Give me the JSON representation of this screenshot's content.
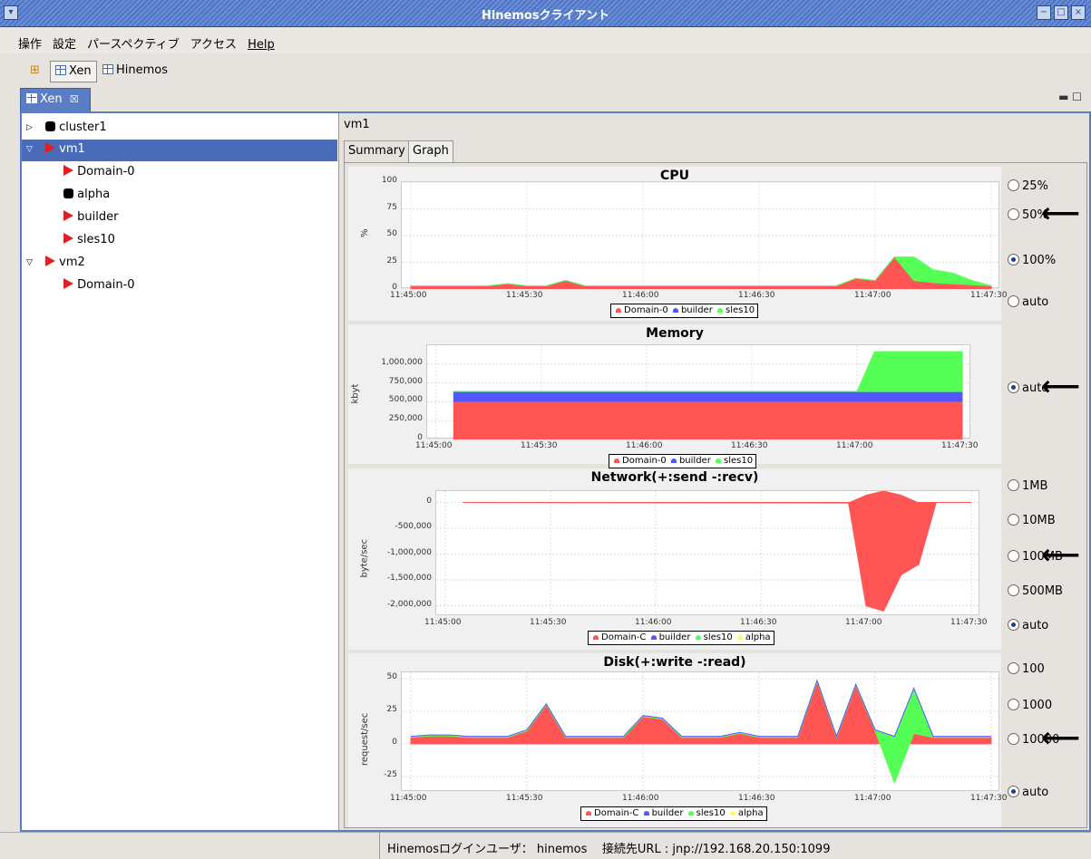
{
  "window": {
    "title": "Hinemosクライアント",
    "controls": [
      "−",
      "□",
      "×"
    ]
  },
  "menu": [
    "操作",
    "設定",
    "パースペクティブ",
    "アクセス",
    "Help"
  ],
  "toolbar": {
    "perspectives": [
      "Xen",
      "Hinemos"
    ],
    "selected": "Xen"
  },
  "view_tab": {
    "label": "Xen",
    "close_icon": "close-icon"
  },
  "tree": [
    {
      "label": "cluster1",
      "icon": "black-node-icon",
      "expander": "▷",
      "depth": 0
    },
    {
      "label": "vm1",
      "icon": "red-arrow-icon",
      "expander": "▽",
      "depth": 0,
      "selected": true
    },
    {
      "label": "Domain-0",
      "icon": "red-arrow-icon",
      "depth": 1
    },
    {
      "label": "alpha",
      "icon": "black-node-icon",
      "depth": 1
    },
    {
      "label": "builder",
      "icon": "red-arrow-icon",
      "depth": 1
    },
    {
      "label": "sles10",
      "icon": "red-arrow-icon",
      "depth": 1
    },
    {
      "label": "vm2",
      "icon": "red-arrow-icon",
      "expander": "▽",
      "depth": 0
    },
    {
      "label": "Domain-0",
      "icon": "red-arrow-icon",
      "depth": 1
    }
  ],
  "detail": {
    "title": "vm1",
    "tabs": [
      "Summary",
      "Graph"
    ],
    "active_tab": "Graph"
  },
  "colors": {
    "domain0": "#ff5555",
    "builder": "#5555ff",
    "sles10": "#55ff55",
    "alpha": "#ffff55",
    "selection": "#4a6cb8",
    "tab": "#5a7dc4"
  },
  "chart_data": [
    {
      "type": "area",
      "title": "CPU",
      "ylabel": "%",
      "ylim": [
        0,
        100
      ],
      "yticks": [
        "0",
        "25",
        "50",
        "75",
        "100"
      ],
      "xticks": [
        "11:45:00",
        "11:45:30",
        "11:46:00",
        "11:46:30",
        "11:47:00",
        "11:47:30"
      ],
      "x": [
        "11:45:00",
        "11:45:05",
        "11:45:10",
        "11:45:15",
        "11:45:20",
        "11:45:25",
        "11:45:30",
        "11:45:35",
        "11:45:40",
        "11:45:45",
        "11:45:50",
        "11:45:55",
        "11:46:00",
        "11:46:05",
        "11:46:10",
        "11:46:15",
        "11:46:20",
        "11:46:25",
        "11:46:30",
        "11:46:35",
        "11:46:40",
        "11:46:45",
        "11:46:50",
        "11:46:55",
        "11:47:00",
        "11:47:05",
        "11:47:10",
        "11:47:15",
        "11:47:20",
        "11:47:25",
        "11:47:30"
      ],
      "series": [
        {
          "name": "Domain-0",
          "values": [
            3,
            3,
            3,
            3,
            3,
            5,
            3,
            3,
            8,
            3,
            3,
            3,
            3,
            3,
            3,
            3,
            3,
            3,
            3,
            3,
            3,
            3,
            3,
            10,
            8,
            30,
            8,
            6,
            5,
            4,
            3
          ]
        },
        {
          "name": "builder",
          "values": [
            0,
            0,
            0,
            0,
            0,
            0,
            0,
            0,
            0,
            0,
            0,
            0,
            0,
            0,
            0,
            0,
            0,
            0,
            0,
            0,
            0,
            0,
            0,
            0,
            0,
            0,
            0,
            0,
            0,
            0,
            0
          ]
        },
        {
          "name": "sles10",
          "values": [
            0,
            0,
            0,
            0,
            0,
            0,
            0,
            0,
            0,
            0,
            0,
            0,
            0,
            0,
            0,
            0,
            0,
            0,
            0,
            0,
            0,
            0,
            0,
            0,
            0,
            0,
            22,
            12,
            10,
            4,
            0
          ]
        }
      ],
      "options": [
        "25%",
        "50%",
        "100%",
        "auto"
      ],
      "selected": "100%",
      "legend_position": "bottom"
    },
    {
      "type": "area",
      "title": "Memory",
      "ylabel": "kbyt",
      "ylim": [
        0,
        1250000
      ],
      "yticks": [
        "0",
        "250,000",
        "500,000",
        "750,000",
        "1,000,000"
      ],
      "xticks": [
        "11:45:00",
        "11:45:30",
        "11:46:00",
        "11:46:30",
        "11:47:00",
        "11:47:30"
      ],
      "x": [
        "11:45:05",
        "11:46:55",
        "11:47:00",
        "11:47:05",
        "11:47:30"
      ],
      "series": [
        {
          "name": "Domain-0",
          "values": [
            505000,
            505000,
            505000,
            505000,
            505000
          ]
        },
        {
          "name": "builder",
          "values": [
            130000,
            130000,
            130000,
            130000,
            130000
          ]
        },
        {
          "name": "sles10",
          "values": [
            0,
            0,
            0,
            530000,
            530000
          ]
        }
      ],
      "options": [
        "auto"
      ],
      "selected": "auto",
      "legend_position": "bottom"
    },
    {
      "type": "area",
      "title": "Network(+:send -:recv)",
      "ylabel": "byte/sec",
      "ylim": [
        -2200000,
        220000
      ],
      "yticks": [
        "0",
        "-500,000",
        "-1,000,000",
        "-1,500,000",
        "-2,000,000"
      ],
      "xticks": [
        "11:45:00",
        "11:45:30",
        "11:46:00",
        "11:46:30",
        "11:47:00",
        "11:47:30"
      ],
      "x": [
        "11:45:05",
        "11:46:55",
        "11:47:00",
        "11:47:05",
        "11:47:10",
        "11:47:15",
        "11:47:20",
        "11:47:30"
      ],
      "series": [
        {
          "name": "Domain-0",
          "values": [
            0,
            -10000,
            -2000000,
            -2100000,
            -1400000,
            -1200000,
            0,
            0
          ],
          "send": [
            0,
            0,
            150000,
            230000,
            150000,
            0,
            0,
            0
          ]
        },
        {
          "name": "builder",
          "values": [
            0,
            0,
            0,
            0,
            0,
            0,
            0,
            0
          ]
        },
        {
          "name": "sles10",
          "values": [
            0,
            0,
            0,
            0,
            0,
            0,
            0,
            0
          ]
        },
        {
          "name": "alpha",
          "values": [
            0,
            0,
            0,
            0,
            0,
            0,
            0,
            0
          ]
        }
      ],
      "legend": [
        "Domain-C",
        "builder",
        "sles10",
        "alpha"
      ],
      "options": [
        "1MB",
        "10MB",
        "100MB",
        "500MB",
        "auto"
      ],
      "selected": "auto",
      "legend_position": "bottom"
    },
    {
      "type": "area",
      "title": "Disk(+:write -:read)",
      "ylabel": "request/sec",
      "ylim": [
        -37,
        55
      ],
      "yticks": [
        "50",
        "25",
        "0",
        "-25"
      ],
      "xticks": [
        "11:45:00",
        "11:45:30",
        "11:46:00",
        "11:46:30",
        "11:47:00",
        "11:47:30"
      ],
      "x": [
        "11:45:00",
        "11:45:05",
        "11:45:10",
        "11:45:15",
        "11:45:20",
        "11:45:25",
        "11:45:30",
        "11:45:35",
        "11:45:40",
        "11:45:45",
        "11:45:50",
        "11:45:55",
        "11:46:00",
        "11:46:05",
        "11:46:10",
        "11:46:15",
        "11:46:20",
        "11:46:25",
        "11:46:30",
        "11:46:35",
        "11:46:40",
        "11:46:45",
        "11:46:50",
        "11:46:55",
        "11:47:00",
        "11:47:05",
        "11:47:10",
        "11:47:15",
        "11:47:20",
        "11:47:25",
        "11:47:30"
      ],
      "series": [
        {
          "name": "Domain-0",
          "values": [
            5,
            6,
            6,
            5,
            5,
            5,
            10,
            30,
            5,
            5,
            5,
            5,
            21,
            19,
            5,
            5,
            5,
            8,
            5,
            5,
            5,
            48,
            5,
            45,
            10,
            5,
            42,
            5,
            5,
            5,
            5
          ]
        },
        {
          "name": "builder",
          "values": [
            0,
            0,
            0,
            0,
            0,
            0,
            0,
            0,
            0,
            0,
            0,
            0,
            0,
            0,
            0,
            0,
            0,
            0,
            0,
            0,
            0,
            0,
            0,
            0,
            0,
            0,
            0,
            0,
            0,
            0,
            0
          ]
        },
        {
          "name": "sles10",
          "values": [
            0,
            0,
            0,
            0,
            0,
            0,
            0,
            0,
            0,
            0,
            0,
            0,
            0,
            0,
            0,
            0,
            0,
            0,
            0,
            0,
            0,
            0,
            0,
            0,
            0,
            -35,
            -34,
            0,
            0,
            0,
            0
          ]
        },
        {
          "name": "alpha",
          "values": [
            0,
            0,
            0,
            0,
            0,
            0,
            0,
            0,
            0,
            0,
            0,
            0,
            0,
            0,
            0,
            0,
            0,
            0,
            0,
            0,
            0,
            0,
            0,
            0,
            0,
            0,
            0,
            0,
            0,
            0,
            0
          ]
        }
      ],
      "legend": [
        "Domain-C",
        "builder",
        "sles10",
        "alpha"
      ],
      "options": [
        "100",
        "1000",
        "10000",
        "auto"
      ],
      "selected": "auto",
      "legend_position": "bottom"
    }
  ],
  "status": {
    "user_label": "Hinemosログインユーザ：",
    "user": "hinemos",
    "url_label": "接続先URL :",
    "url": "jnp://192.168.20.150:1099"
  }
}
